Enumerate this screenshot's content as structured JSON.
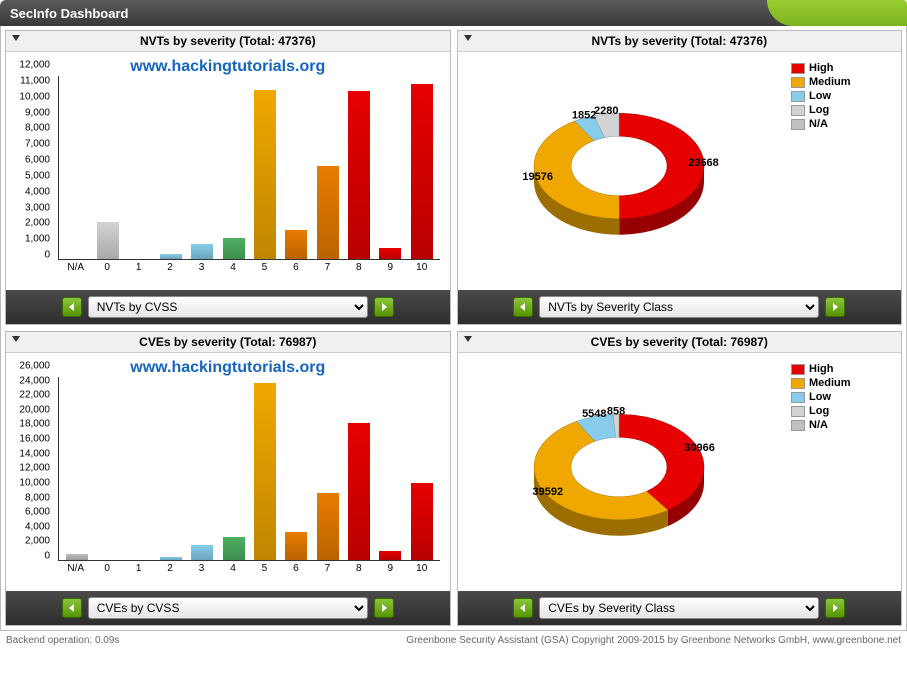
{
  "header": {
    "title": "SecInfo Dashboard"
  },
  "colors": {
    "high": "#e60000",
    "medium": "#f0a800",
    "medium_dark": "#e87c00",
    "low": "#87cdeb",
    "log": "#d3d3d3",
    "na": "#c0c0c0",
    "low_green": "#4db060"
  },
  "panels": [
    {
      "title": "NVTs by severity (Total: 47376)",
      "watermark": "www.hackingtutorials.org",
      "select": "NVTs by CVSS",
      "kind": "bar",
      "chart_key": "nvts_cvss"
    },
    {
      "title": "NVTs by severity (Total: 47376)",
      "select": "NVTs by Severity Class",
      "kind": "donut",
      "chart_key": "nvts_class"
    },
    {
      "title": "CVEs by severity (Total: 76987)",
      "watermark": "www.hackingtutorials.org",
      "select": "CVEs by CVSS",
      "kind": "bar",
      "chart_key": "cves_cvss"
    },
    {
      "title": "CVEs by severity (Total: 76987)",
      "select": "CVEs by Severity Class",
      "kind": "donut",
      "chart_key": "cves_class"
    }
  ],
  "legend": [
    {
      "label": "High",
      "colorKey": "high"
    },
    {
      "label": "Medium",
      "colorKey": "medium"
    },
    {
      "label": "Low",
      "colorKey": "low"
    },
    {
      "label": "Log",
      "colorKey": "log"
    },
    {
      "label": "N/A",
      "colorKey": "na"
    }
  ],
  "status": {
    "left": "Backend operation: 0.09s",
    "right": "Greenbone Security Assistant (GSA) Copyright 2009-2015 by Greenbone Networks GmbH, www.greenbone.net"
  },
  "chart_data": {
    "nvts_cvss": {
      "type": "bar",
      "title": "NVTs by severity (Total: 47376)",
      "xlabel": "",
      "ylabel": "",
      "categories": [
        "N/A",
        "0",
        "1",
        "2",
        "3",
        "4",
        "5",
        "6",
        "7",
        "8",
        "9",
        "10"
      ],
      "values": [
        0,
        2400,
        0,
        300,
        1000,
        1400,
        11100,
        1900,
        6100,
        11000,
        700,
        11500
      ],
      "colors": [
        "na",
        "log",
        "low",
        "low",
        "low",
        "low_green",
        "medium",
        "medium_dark",
        "medium_dark",
        "high",
        "high",
        "high"
      ],
      "ylim": [
        0,
        12000
      ],
      "ystep": 1000
    },
    "nvts_class": {
      "type": "pie",
      "title": "NVTs by severity (Total: 47376)",
      "series": [
        {
          "name": "High",
          "value": 23668,
          "colorKey": "high"
        },
        {
          "name": "Medium",
          "value": 19576,
          "colorKey": "medium"
        },
        {
          "name": "Low",
          "value": 1852,
          "colorKey": "low"
        },
        {
          "name": "Log",
          "value": 2280,
          "colorKey": "log"
        }
      ]
    },
    "cves_cvss": {
      "type": "bar",
      "title": "CVEs by severity (Total: 76987)",
      "xlabel": "",
      "ylabel": "",
      "categories": [
        "N/A",
        "0",
        "1",
        "2",
        "3",
        "4",
        "5",
        "6",
        "7",
        "8",
        "9",
        "10"
      ],
      "values": [
        900,
        0,
        0,
        400,
        2200,
        3200,
        25200,
        4000,
        9500,
        19400,
        1300,
        11000
      ],
      "colors": [
        "na",
        "log",
        "low",
        "low",
        "low",
        "low_green",
        "medium",
        "medium_dark",
        "medium_dark",
        "high",
        "high",
        "high"
      ],
      "ylim": [
        0,
        26000
      ],
      "ystep": 2000
    },
    "cves_class": {
      "type": "pie",
      "title": "CVEs by severity (Total: 76987)",
      "series": [
        {
          "name": "High",
          "value": 30966,
          "colorKey": "high"
        },
        {
          "name": "Medium",
          "value": 39592,
          "colorKey": "medium"
        },
        {
          "name": "Low",
          "value": 5548,
          "colorKey": "low"
        },
        {
          "name": "Log",
          "value": 858,
          "colorKey": "log"
        }
      ]
    }
  }
}
